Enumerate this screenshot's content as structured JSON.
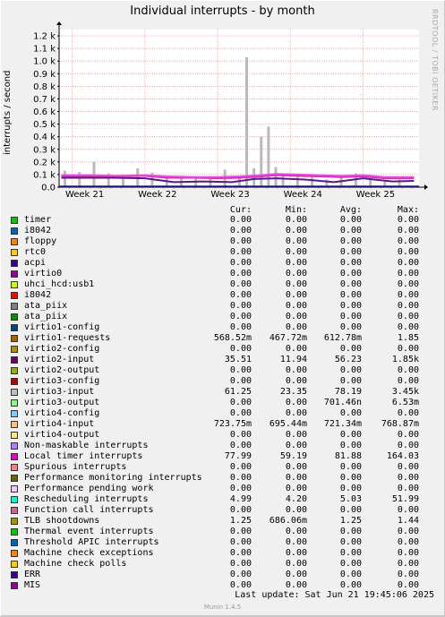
{
  "chart_data": {
    "type": "area",
    "title": "Individual interrupts - by month",
    "ylabel": "interrupts / second",
    "credit": "RRDTOOL / TOBI OETIKER",
    "y_ticks": [
      "0.0",
      "0.1 k",
      "0.2 k",
      "0.3 k",
      "0.4 k",
      "0.5 k",
      "0.6 k",
      "0.7 k",
      "0.8 k",
      "0.9 k",
      "1.0 k",
      "1.1 k",
      "1.2 k"
    ],
    "ylim": [
      0,
      1250
    ],
    "x_ticks": [
      "Week 21",
      "Week 22",
      "Week 23",
      "Week 24",
      "Week 25"
    ],
    "xlim_weeks": [
      20.82,
      25.77
    ],
    "grid": true,
    "series": [
      {
        "name": "virtio3-input",
        "color": "#b9b9b9",
        "style": "bars",
        "x": [
          20.9,
          21.1,
          21.3,
          21.5,
          21.7,
          21.9,
          22.1,
          22.3,
          22.5,
          22.7,
          22.9,
          23.1,
          23.3,
          23.4,
          23.5,
          23.6,
          23.7,
          23.8,
          23.9,
          24.1,
          24.3,
          24.5,
          24.7,
          24.9,
          25.1,
          25.3,
          25.5
        ],
        "y": [
          130,
          120,
          200,
          110,
          100,
          150,
          115,
          90,
          80,
          75,
          80,
          140,
          70,
          1030,
          150,
          400,
          480,
          160,
          95,
          100,
          80,
          60,
          80,
          110,
          70,
          55,
          60
        ]
      },
      {
        "name": "virtio1-requests",
        "color": "#cc3399",
        "style": "line",
        "x": [
          20.85,
          21.2,
          21.6,
          22.0,
          22.3,
          22.7,
          23.0,
          23.3,
          23.6,
          23.8,
          24.1,
          24.4,
          24.7,
          25.0,
          25.3,
          25.7
        ],
        "y": [
          85,
          90,
          85,
          90,
          75,
          75,
          70,
          75,
          85,
          95,
          90,
          85,
          80,
          85,
          70,
          70
        ]
      },
      {
        "name": "virtio4-input",
        "color": "#ee44ee",
        "style": "line",
        "x": [
          20.85,
          21.2,
          21.6,
          22.0,
          22.3,
          22.7,
          23.0,
          23.3,
          23.6,
          23.8,
          24.1,
          24.4,
          24.7,
          25.0,
          25.3,
          25.7
        ],
        "y": [
          95,
          95,
          90,
          95,
          85,
          80,
          80,
          85,
          95,
          105,
          100,
          95,
          90,
          95,
          80,
          80
        ]
      },
      {
        "name": "Local timer interrupts",
        "color": "#551a8b",
        "style": "line",
        "x": [
          20.85,
          21.5,
          22.0,
          22.4,
          22.8,
          23.2,
          23.5,
          23.8,
          24.2,
          24.6,
          25.0,
          25.4,
          25.7
        ],
        "y": [
          75,
          75,
          70,
          40,
          45,
          40,
          65,
          70,
          60,
          40,
          70,
          45,
          50
        ]
      }
    ],
    "legend_headers": [
      "Cur:",
      "Min:",
      "Avg:",
      "Max:"
    ],
    "legend": [
      {
        "name": "timer",
        "color": "#00cc00",
        "cur": "0.00",
        "min": "0.00",
        "avg": "0.00",
        "max": "0.00"
      },
      {
        "name": "i8042",
        "color": "#0066b3",
        "cur": "0.00",
        "min": "0.00",
        "avg": "0.00",
        "max": "0.00"
      },
      {
        "name": "floppy",
        "color": "#ff8000",
        "cur": "0.00",
        "min": "0.00",
        "avg": "0.00",
        "max": "0.00"
      },
      {
        "name": "rtc0",
        "color": "#ffcc00",
        "cur": "0.00",
        "min": "0.00",
        "avg": "0.00",
        "max": "0.00"
      },
      {
        "name": "acpi",
        "color": "#330099",
        "cur": "0.00",
        "min": "0.00",
        "avg": "0.00",
        "max": "0.00"
      },
      {
        "name": "virtio0",
        "color": "#990099",
        "cur": "0.00",
        "min": "0.00",
        "avg": "0.00",
        "max": "0.00"
      },
      {
        "name": "uhci_hcd:usb1",
        "color": "#ccff00",
        "cur": "0.00",
        "min": "0.00",
        "avg": "0.00",
        "max": "0.00"
      },
      {
        "name": "i8042",
        "color": "#ff0000",
        "cur": "0.00",
        "min": "0.00",
        "avg": "0.00",
        "max": "0.00"
      },
      {
        "name": "ata_piix",
        "color": "#808080",
        "cur": "0.00",
        "min": "0.00",
        "avg": "0.00",
        "max": "0.00"
      },
      {
        "name": "ata_piix",
        "color": "#008f00",
        "cur": "0.00",
        "min": "0.00",
        "avg": "0.00",
        "max": "0.00"
      },
      {
        "name": "virtio1-config",
        "color": "#00487d",
        "cur": "0.00",
        "min": "0.00",
        "avg": "0.00",
        "max": "0.00"
      },
      {
        "name": "virtio1-requests",
        "color": "#b35a00",
        "cur": "568.52m",
        "min": "467.72m",
        "avg": "612.78m",
        "max": "1.85"
      },
      {
        "name": "virtio2-config",
        "color": "#b38f00",
        "cur": "0.00",
        "min": "0.00",
        "avg": "0.00",
        "max": "0.00"
      },
      {
        "name": "virtio2-input",
        "color": "#6b006b",
        "cur": "35.51",
        "min": "11.94",
        "avg": "56.23",
        "max": "1.85k"
      },
      {
        "name": "virtio2-output",
        "color": "#8fb300",
        "cur": "0.00",
        "min": "0.00",
        "avg": "0.00",
        "max": "0.00"
      },
      {
        "name": "virtio3-config",
        "color": "#b30000",
        "cur": "0.00",
        "min": "0.00",
        "avg": "0.00",
        "max": "0.00"
      },
      {
        "name": "virtio3-input",
        "color": "#bebebe",
        "cur": "61.25",
        "min": "23.35",
        "avg": "78.19",
        "max": "3.45k"
      },
      {
        "name": "virtio3-output",
        "color": "#80ff80",
        "cur": "0.00",
        "min": "0.00",
        "avg": "701.46n",
        "max": "6.53m"
      },
      {
        "name": "virtio4-config",
        "color": "#80c9ff",
        "cur": "0.00",
        "min": "0.00",
        "avg": "0.00",
        "max": "0.00"
      },
      {
        "name": "virtio4-input",
        "color": "#ffc080",
        "cur": "723.75m",
        "min": "695.44m",
        "avg": "721.34m",
        "max": "768.87m"
      },
      {
        "name": "virtio4-output",
        "color": "#ffe680",
        "cur": "0.00",
        "min": "0.00",
        "avg": "0.00",
        "max": "0.00"
      },
      {
        "name": "Non-maskable interrupts",
        "color": "#aa80ff",
        "cur": "0.00",
        "min": "0.00",
        "avg": "0.00",
        "max": "0.00"
      },
      {
        "name": "Local timer interrupts",
        "color": "#ee00cc",
        "cur": "77.99",
        "min": "59.19",
        "avg": "81.88",
        "max": "164.03"
      },
      {
        "name": "Spurious interrupts",
        "color": "#ff8080",
        "cur": "0.00",
        "min": "0.00",
        "avg": "0.00",
        "max": "0.00"
      },
      {
        "name": "Performance monitoring interrupts",
        "color": "#666600",
        "cur": "0.00",
        "min": "0.00",
        "avg": "0.00",
        "max": "0.00"
      },
      {
        "name": "Performance pending work",
        "color": "#ffbfff",
        "cur": "0.00",
        "min": "0.00",
        "avg": "0.00",
        "max": "0.00"
      },
      {
        "name": "Rescheduling interrupts",
        "color": "#00ffcc",
        "cur": "4.99",
        "min": "4.20",
        "avg": "5.03",
        "max": "51.99"
      },
      {
        "name": "Function call interrupts",
        "color": "#cc6699",
        "cur": "0.00",
        "min": "0.00",
        "avg": "0.00",
        "max": "0.00"
      },
      {
        "name": "TLB shootdowns",
        "color": "#999900",
        "cur": "1.25",
        "min": "686.06m",
        "avg": "1.25",
        "max": "1.44"
      },
      {
        "name": "Thermal event interrupts",
        "color": "#00cc00",
        "cur": "0.00",
        "min": "0.00",
        "avg": "0.00",
        "max": "0.00"
      },
      {
        "name": "Threshold APIC interrupts",
        "color": "#0066b3",
        "cur": "0.00",
        "min": "0.00",
        "avg": "0.00",
        "max": "0.00"
      },
      {
        "name": "Machine check exceptions",
        "color": "#ff8000",
        "cur": "0.00",
        "min": "0.00",
        "avg": "0.00",
        "max": "0.00"
      },
      {
        "name": "Machine check polls",
        "color": "#ffcc00",
        "cur": "0.00",
        "min": "0.00",
        "avg": "0.00",
        "max": "0.00"
      },
      {
        "name": "ERR",
        "color": "#330099",
        "cur": "0.00",
        "min": "0.00",
        "avg": "0.00",
        "max": "0.00"
      },
      {
        "name": "MIS",
        "color": "#990099",
        "cur": "0.00",
        "min": "0.00",
        "avg": "0.00",
        "max": "0.00"
      }
    ]
  },
  "footer": {
    "last_update": "Last update:  Sat Jun 21 19:45:06 2025",
    "version": "Munin 1.4.5"
  }
}
